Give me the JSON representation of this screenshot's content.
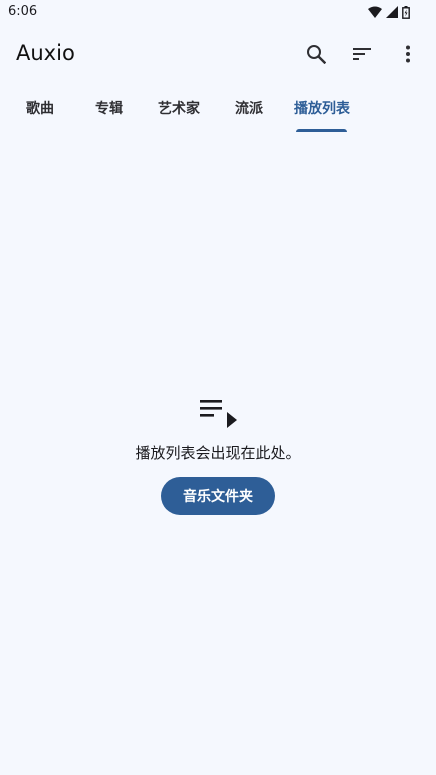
{
  "status_bar": {
    "time": "6:06",
    "icons": [
      "wifi-icon",
      "signal-icon",
      "battery-icon"
    ]
  },
  "app_bar": {
    "title": "Auxio",
    "actions": [
      "search-icon",
      "sort-icon",
      "more-vert-icon"
    ]
  },
  "tabs": {
    "items": [
      {
        "label": "歌曲"
      },
      {
        "label": "专辑"
      },
      {
        "label": "艺术家"
      },
      {
        "label": "流派"
      },
      {
        "label": "播放列表"
      }
    ],
    "active_index": 4
  },
  "empty_state": {
    "icon": "playlist-play-icon",
    "message": "播放列表会出现在此处。",
    "button_label": "音乐文件夹"
  },
  "colors": {
    "background": "#f5f8fe",
    "accent": "#2e5e97",
    "text": "#1b1b1f"
  }
}
